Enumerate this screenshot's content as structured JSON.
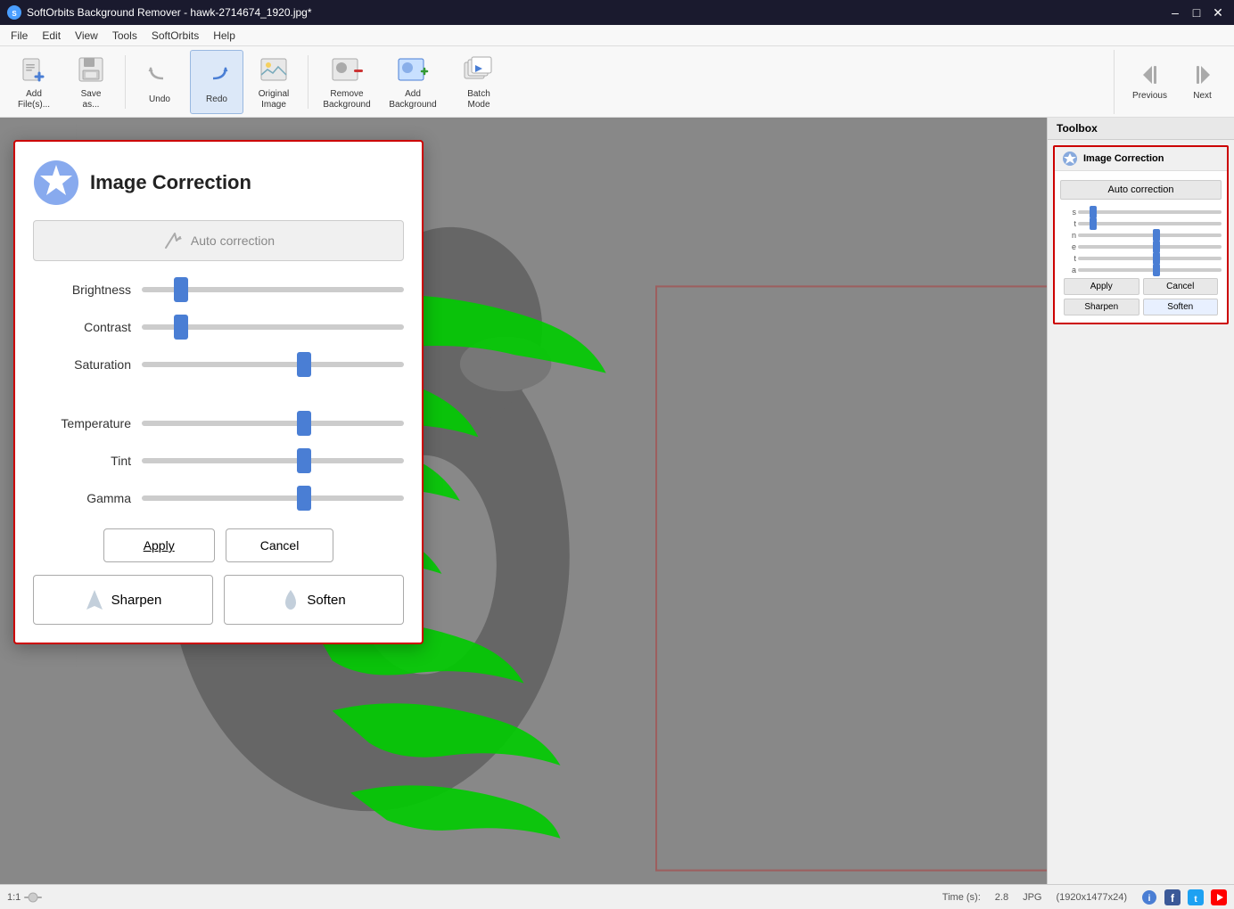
{
  "titlebar": {
    "title": "SoftOrbits Background Remover - hawk-2714674_1920.jpg*",
    "icon_label": "SO"
  },
  "menubar": {
    "items": [
      "File",
      "Edit",
      "View",
      "Tools",
      "SoftOrbits",
      "Help"
    ]
  },
  "toolbar": {
    "items": [
      {
        "id": "add-file",
        "label": "Add\nFile(s)...",
        "icon": "add-file-icon"
      },
      {
        "id": "save-as",
        "label": "Save\nas...",
        "icon": "save-icon"
      },
      {
        "id": "undo",
        "label": "Undo",
        "icon": "undo-icon"
      },
      {
        "id": "redo",
        "label": "Redo",
        "icon": "redo-icon"
      },
      {
        "id": "original-image",
        "label": "Original\nImage",
        "icon": "original-icon"
      },
      {
        "id": "remove-background",
        "label": "Remove\nBackground",
        "icon": "remove-bg-icon"
      },
      {
        "id": "add-background",
        "label": "Add\nBackground",
        "icon": "add-bg-icon"
      },
      {
        "id": "batch-mode",
        "label": "Batch\nMode",
        "icon": "batch-icon"
      }
    ],
    "nav": {
      "previous_label": "Previous",
      "next_label": "Next"
    }
  },
  "toolbox": {
    "title": "Toolbox",
    "panel": {
      "title": "Image Correction",
      "auto_correction_label": "Auto correction",
      "sliders": [
        {
          "id": "brightness",
          "abbr": "s",
          "value": 12
        },
        {
          "id": "contrast",
          "abbr": "t",
          "value": 12
        },
        {
          "id": "saturation",
          "abbr": "n",
          "value": 55
        },
        {
          "id": "temperature",
          "abbr": "e",
          "value": 55
        },
        {
          "id": "tint",
          "abbr": "t",
          "value": 55
        },
        {
          "id": "gamma",
          "abbr": "a",
          "value": 55
        }
      ],
      "apply_label": "Apply",
      "cancel_label": "Cancel",
      "sharpen_label": "Sharpen",
      "soften_label": "Soften"
    }
  },
  "dialog": {
    "title": "Image Correction",
    "auto_correction_label": "Auto correction",
    "sliders": [
      {
        "id": "brightness",
        "label": "Brightness",
        "value": 15
      },
      {
        "id": "contrast",
        "label": "Contrast",
        "value": 15
      },
      {
        "id": "saturation",
        "label": "Saturation",
        "value": 62
      },
      {
        "id": "temperature",
        "label": "Temperature",
        "value": 62
      },
      {
        "id": "tint",
        "label": "Tint",
        "value": 62
      },
      {
        "id": "gamma",
        "label": "Gamma",
        "value": 62
      }
    ],
    "apply_label": "Apply",
    "cancel_label": "Cancel",
    "sharpen_label": "Sharpen",
    "soften_label": "Soften"
  },
  "statusbar": {
    "zoom": "1:1",
    "time_label": "Time (s):",
    "time_value": "2.8",
    "format": "JPG",
    "dimensions": "(1920x1477x24)"
  },
  "canvas": {
    "bg_color": "#888888"
  }
}
